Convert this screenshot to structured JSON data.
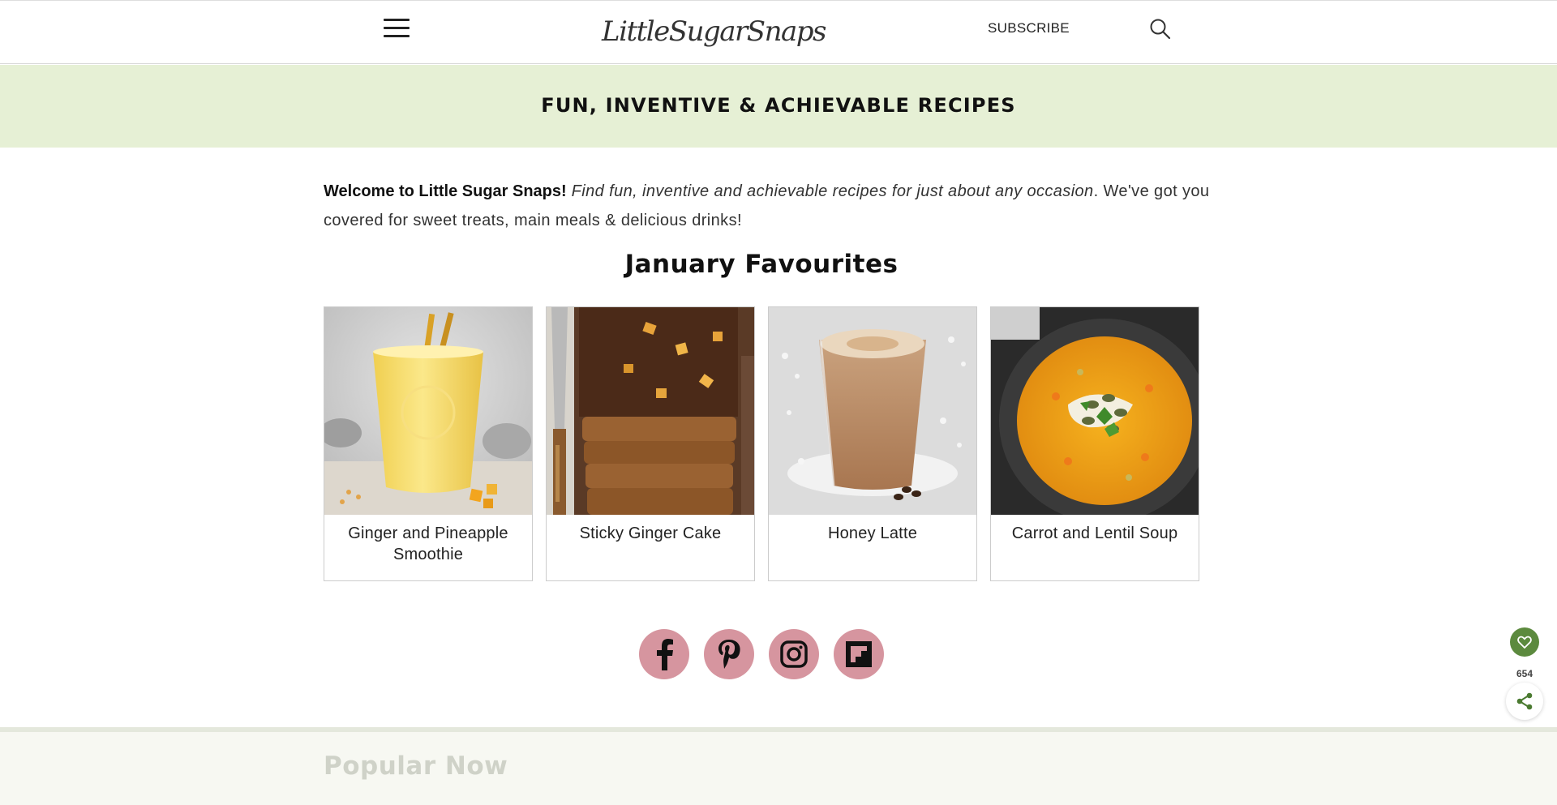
{
  "header": {
    "logo_text": "LittleSugarSnaps",
    "subscribe_label": "SUBSCRIBE"
  },
  "tagline": "FUN, INVENTIVE & ACHIEVABLE RECIPES",
  "intro": {
    "bold": "Welcome to Little Sugar Snaps!",
    "italic": "Find fun, inventive and achievable recipes for just about any occasion",
    "rest": ". We've got you covered for sweet treats, main meals & delicious drinks!"
  },
  "section_title": "January Favourites",
  "cards": [
    {
      "title": "Ginger and Pineapple Smoothie"
    },
    {
      "title": "Sticky Ginger Cake"
    },
    {
      "title": "Honey Latte"
    },
    {
      "title": "Carrot and Lentil Soup"
    }
  ],
  "social": [
    "facebook-icon",
    "pinterest-icon",
    "instagram-icon",
    "flipboard-icon"
  ],
  "share": {
    "count": "654"
  },
  "popular_title": "Popular Now",
  "colors": {
    "tag_band": "#e6f0d5",
    "social_bg": "#d6959f",
    "share_green": "#5c8a3e"
  }
}
